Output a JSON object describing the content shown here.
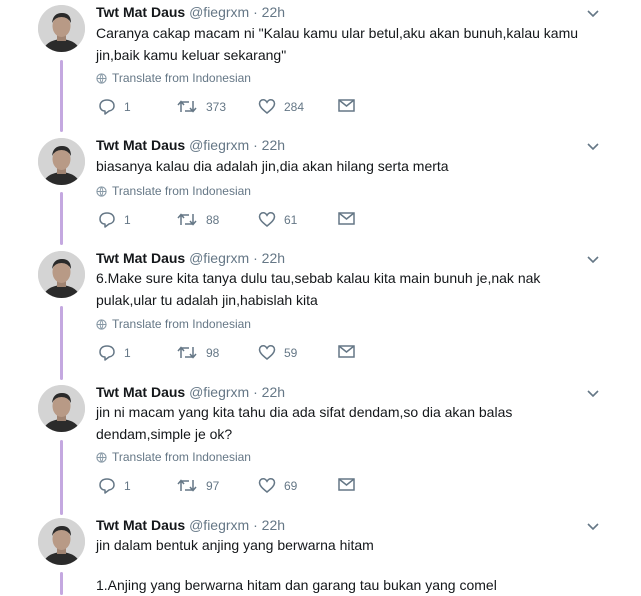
{
  "translate_label": "Translate from Indonesian",
  "colors": {
    "thread_line": "#c4a8e0",
    "secondary_text": "#657786",
    "primary_text": "#14171a"
  },
  "tweets": [
    {
      "name": "Twt Mat Daus",
      "handle": "@fiegrxm",
      "dot": "·",
      "time": "22h",
      "text_lines": [
        "Caranya cakap macam ni \"Kalau kamu ular betul,aku akan bunuh,kalau kamu",
        "jin,baik kamu keluar sekarang\""
      ],
      "replies": "1",
      "retweets": "373",
      "likes": "284"
    },
    {
      "name": "Twt Mat Daus",
      "handle": "@fiegrxm",
      "dot": "·",
      "time": "22h",
      "text_lines": [
        "biasanya kalau dia adalah jin,dia akan hilang serta merta"
      ],
      "replies": "1",
      "retweets": "88",
      "likes": "61"
    },
    {
      "name": "Twt Mat Daus",
      "handle": "@fiegrxm",
      "dot": "·",
      "time": "22h",
      "text_lines": [
        "6.Make sure kita tanya dulu tau,sebab kalau kita main bunuh je,nak nak",
        "pulak,ular tu adalah jin,habislah kita"
      ],
      "replies": "1",
      "retweets": "98",
      "likes": "59"
    },
    {
      "name": "Twt Mat Daus",
      "handle": "@fiegrxm",
      "dot": "·",
      "time": "22h",
      "text_lines": [
        "jin ni macam yang kita tahu dia ada sifat dendam,so dia akan balas",
        "dendam,simple je ok?"
      ],
      "replies": "1",
      "retweets": "97",
      "likes": "69"
    },
    {
      "name": "Twt Mat Daus",
      "handle": "@fiegrxm",
      "dot": "·",
      "time": "22h",
      "text_lines": [
        "jin dalam bentuk anjing yang berwarna hitam",
        "",
        "1.Anjing yang berwarna hitam dan garang tau bukan yang comel"
      ]
    }
  ]
}
